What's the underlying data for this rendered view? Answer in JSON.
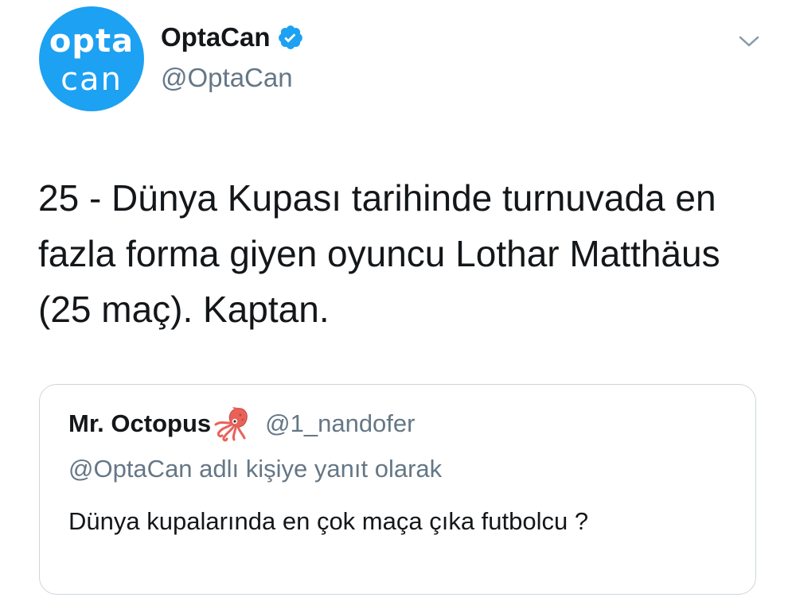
{
  "author": {
    "avatar_line1": "opta",
    "avatar_line2": "can",
    "display_name": "OptaCan",
    "handle": "@OptaCan",
    "verified": true,
    "verified_color": "#1da1f2",
    "avatar_color": "#1da1f2"
  },
  "tweet": {
    "text": "25 - Dünya Kupası tarihinde turnuvada en fazla forma giyen oyuncu Lothar Matthäus (25 maç). Kaptan."
  },
  "quoted_tweet": {
    "display_name": "Mr. Octopus",
    "emoji_icon": "squid-icon",
    "handle": "@1_nandofer",
    "reply_context": "@OptaCan adlı kişiye yanıt olarak",
    "text": "Dünya kupalarında en çok maça çıka futbolcu ?"
  },
  "icons": {
    "menu": "chevron-down-icon",
    "verified": "verified-badge-icon"
  },
  "colors": {
    "text_primary": "#14171a",
    "text_secondary": "#657786",
    "border": "#ccd6dd"
  }
}
